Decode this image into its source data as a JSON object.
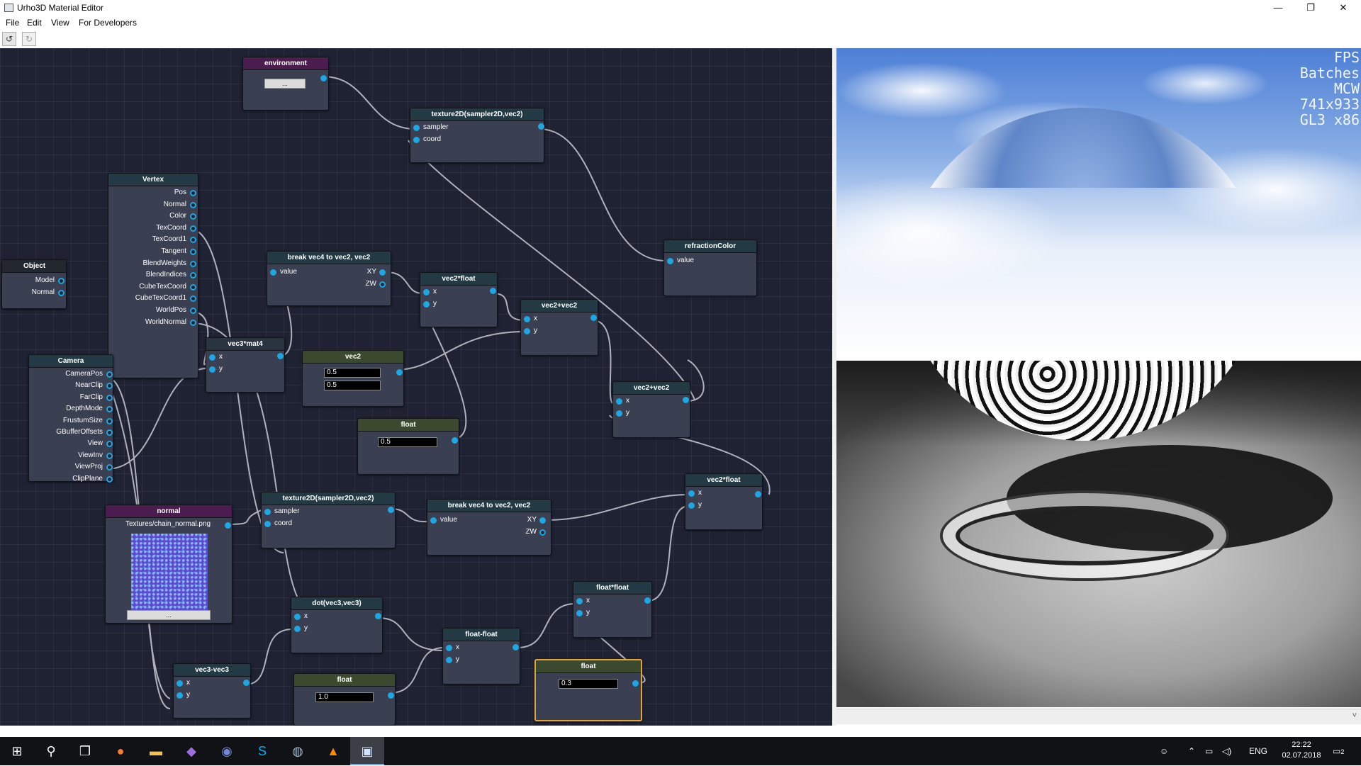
{
  "window": {
    "title": "Urho3D Material Editor",
    "minimize": "—",
    "maximize": "❐",
    "close": "✕"
  },
  "menu": {
    "items": [
      "File",
      "Edit",
      "View",
      "For Developers"
    ]
  },
  "toolbar": {
    "undo": "↺",
    "redo": "↻"
  },
  "nodes": {
    "environment": {
      "title": "environment",
      "button": "..."
    },
    "tex2d_top": {
      "title": "texture2D(sampler2D,vec2)",
      "in": [
        "sampler",
        "coord"
      ]
    },
    "vertex": {
      "title": "Vertex",
      "out": [
        "Pos",
        "Normal",
        "Color",
        "TexCoord",
        "TexCoord1",
        "Tangent",
        "BlendWeights",
        "BlendIndices",
        "CubeTexCoord",
        "CubeTexCoord1",
        "WorldPos",
        "WorldNormal"
      ]
    },
    "object": {
      "title": "Object",
      "out": [
        "Model",
        "Normal"
      ]
    },
    "break1": {
      "title": "break vec4 to vec2, vec2",
      "in": [
        "value"
      ],
      "out": [
        "XY",
        "ZW"
      ]
    },
    "v2f_1": {
      "title": "vec2*float",
      "in": [
        "x",
        "y"
      ]
    },
    "v2add_1": {
      "title": "vec2+vec2",
      "in": [
        "x",
        "y"
      ]
    },
    "refraction": {
      "title": "refractionColor",
      "in": [
        "value"
      ]
    },
    "v3m4": {
      "title": "vec3*mat4",
      "in": [
        "x",
        "y"
      ]
    },
    "vec2": {
      "title": "vec2",
      "values": [
        "0.5",
        "0.5"
      ]
    },
    "camera": {
      "title": "Camera",
      "out": [
        "CameraPos",
        "NearClip",
        "FarClip",
        "DepthMode",
        "FrustumSize",
        "GBufferOffsets",
        "View",
        "ViewInv",
        "ViewProj",
        "ClipPlane"
      ]
    },
    "float_a": {
      "title": "float",
      "value": "0.5"
    },
    "v2add_2": {
      "title": "vec2+vec2",
      "in": [
        "x",
        "y"
      ]
    },
    "normal": {
      "title": "normal",
      "path": "Textures/chain_normal.png",
      "button": "..."
    },
    "tex2d_bot": {
      "title": "texture2D(sampler2D,vec2)",
      "in": [
        "sampler",
        "coord"
      ]
    },
    "break2": {
      "title": "break vec4 to vec2, vec2",
      "in": [
        "value"
      ],
      "out": [
        "XY",
        "ZW"
      ]
    },
    "v2f_2": {
      "title": "vec2*float",
      "in": [
        "x",
        "y"
      ]
    },
    "dot": {
      "title": "dot(vec3,vec3)",
      "in": [
        "x",
        "y"
      ]
    },
    "ff_mul": {
      "title": "float*float",
      "in": [
        "x",
        "y"
      ]
    },
    "ff_sub": {
      "title": "float-float",
      "in": [
        "x",
        "y"
      ]
    },
    "v3sub": {
      "title": "vec3-vec3",
      "in": [
        "x",
        "y"
      ]
    },
    "float_b": {
      "title": "float",
      "value": "1.0"
    },
    "float_c": {
      "title": "float",
      "value": "0.3"
    }
  },
  "viewport": {
    "stats": [
      "FPS",
      "Batches",
      "MCW",
      "741x933",
      "GL3 x86"
    ],
    "scroll_glyph": "˅"
  },
  "taskbar": {
    "apps": [
      "start-icon",
      "search-icon",
      "task-view-icon",
      "firefox-icon",
      "folder-icon",
      "visual-studio-icon",
      "discord-icon",
      "skype-icon",
      "steam-icon",
      "vlc-icon",
      "material-editor-icon"
    ],
    "lang": "ENG",
    "time": "22:22",
    "date": "02.07.2018",
    "notifications": "2"
  },
  "colors": {
    "graph_bg": "#1f2233",
    "port": "#1da7e3",
    "title_teal": "#233a44",
    "title_purple": "#4b1d4f",
    "title_olive": "#3b4a2e",
    "selected": "#e3a43c"
  }
}
